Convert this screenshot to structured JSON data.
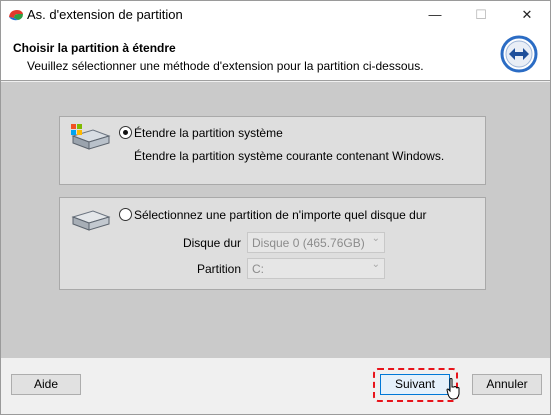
{
  "window": {
    "title": "As. d'extension de partition",
    "minimize_icon": "minimize-icon",
    "maximize_icon": "maximize-icon",
    "close_icon": "close-icon",
    "minimize_glyph": "—",
    "maximize_glyph": "☐",
    "close_glyph": "✕"
  },
  "header": {
    "title": "Choisir la partition à étendre",
    "description": "Veuillez sélectionner une méthode d'extension pour la partition ci-dessous.",
    "icon": "resize-arrows-icon",
    "accent_color": "#1f5fb3"
  },
  "options": {
    "system": {
      "label": "Étendre la partition système",
      "description": "Étendre la partition système courante contenant Windows.",
      "checked": true,
      "icon": "windows-disk-icon"
    },
    "any": {
      "label": "Sélectionnez une partition de n'importe quel disque dur",
      "checked": false,
      "icon": "disk-icon",
      "disk_label": "Disque dur",
      "disk_value": "Disque 0 (465.76GB)",
      "partition_label": "Partition",
      "partition_value": "C:"
    }
  },
  "footer": {
    "help_label": "Aide",
    "next_label": "Suivant",
    "cancel_label": "Annuler",
    "highlight_color": "#e8141b"
  }
}
